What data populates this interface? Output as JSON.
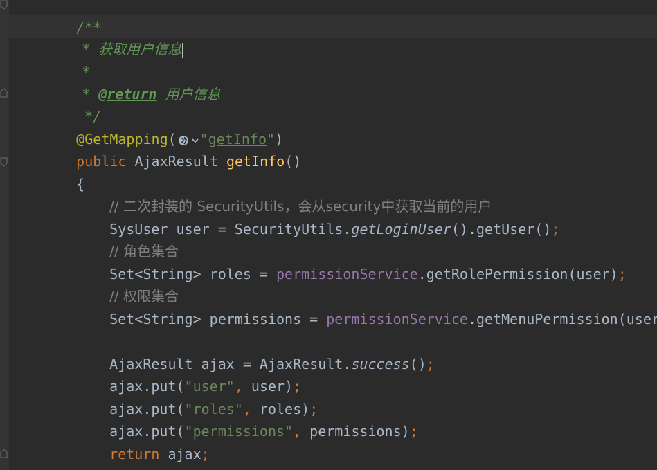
{
  "editor": {
    "lines": {
      "doc_open": "/**",
      "doc_star": "*",
      "doc_desc": "获取用户信息",
      "doc_return_tag": "@return",
      "doc_return_desc": "用户信息",
      "doc_close": "*/",
      "anno_name": "@GetMapping",
      "paren_open": "(",
      "paren_close": ")",
      "quote": "\"",
      "anno_path": "getInfo",
      "kw_public": "public",
      "ret_type": "AjaxResult",
      "method_name": "getInfo",
      "method_parens": "()",
      "brace_open": "{",
      "brace_close": "}",
      "comment1": "// 二次封装的 SecurityUtils，会从security中获取当前的用户",
      "line_user_a": "SysUser user = SecurityUtils.",
      "line_user_b": "getLoginUser",
      "line_user_c": "().getUser()",
      "semicolon": ";",
      "comment2": "// 角色集合",
      "line_roles_a": "Set<String> roles = ",
      "perm_service": "permissionService",
      "line_roles_b": ".getRolePermission(user)",
      "comment3": "// 权限集合",
      "line_perms_a": "Set<String> permissions = ",
      "line_perms_b": ".getMenuPermission(user)",
      "line_ajax_a": "AjaxResult ajax = AjaxResult.",
      "line_ajax_b": "success",
      "line_ajax_c": "()",
      "put_prefix": "ajax.put(",
      "comma": ",",
      "str_user": "\"user\"",
      "arg_user": " user)",
      "str_roles": "\"roles\"",
      "arg_roles": " roles)",
      "str_perms": "\"permissions\"",
      "arg_perms": " permissions)",
      "kw_return": "return",
      "ret_var": " ajax"
    },
    "icons": {
      "web_endpoint": "globe-icon",
      "dropdown": "chevron-down-icon"
    },
    "colors": {
      "background": "#2b2b2b",
      "doc_comment": "#629755",
      "keyword": "#cc7832",
      "annotation": "#bbb529",
      "method": "#ffc66d",
      "string": "#6a8759",
      "field": "#9876aa",
      "line_comment": "#808080",
      "default_text": "#a9b7c6"
    }
  }
}
